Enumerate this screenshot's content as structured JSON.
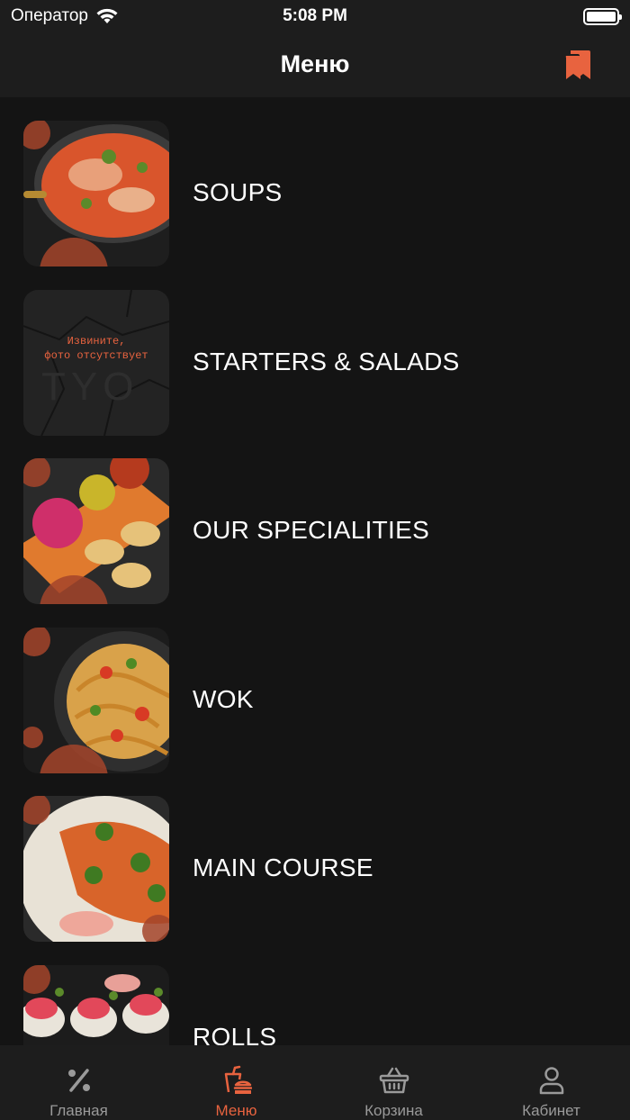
{
  "status_bar": {
    "carrier": "Оператор",
    "time": "5:08 PM"
  },
  "nav": {
    "title": "Меню"
  },
  "menu_items": [
    {
      "label": "SOUPS"
    },
    {
      "label": "STARTERS & SALADS",
      "placeholder_text_line1": "Извините,",
      "placeholder_text_line2": "фото отсутствует"
    },
    {
      "label": "OUR SPECIALITIES"
    },
    {
      "label": "WOK"
    },
    {
      "label": "MAIN COURSE"
    },
    {
      "label": "ROLLS"
    }
  ],
  "tab_bar": {
    "tabs": [
      {
        "label": "Главная",
        "icon": "percent-icon"
      },
      {
        "label": "Меню",
        "icon": "menu-food-icon"
      },
      {
        "label": "Корзина",
        "icon": "basket-icon"
      },
      {
        "label": "Кабинет",
        "icon": "profile-icon"
      }
    ],
    "active_tab": "Меню"
  },
  "colors": {
    "accent": "#e8633f",
    "background": "#141414",
    "bar": "#1d1d1d"
  }
}
